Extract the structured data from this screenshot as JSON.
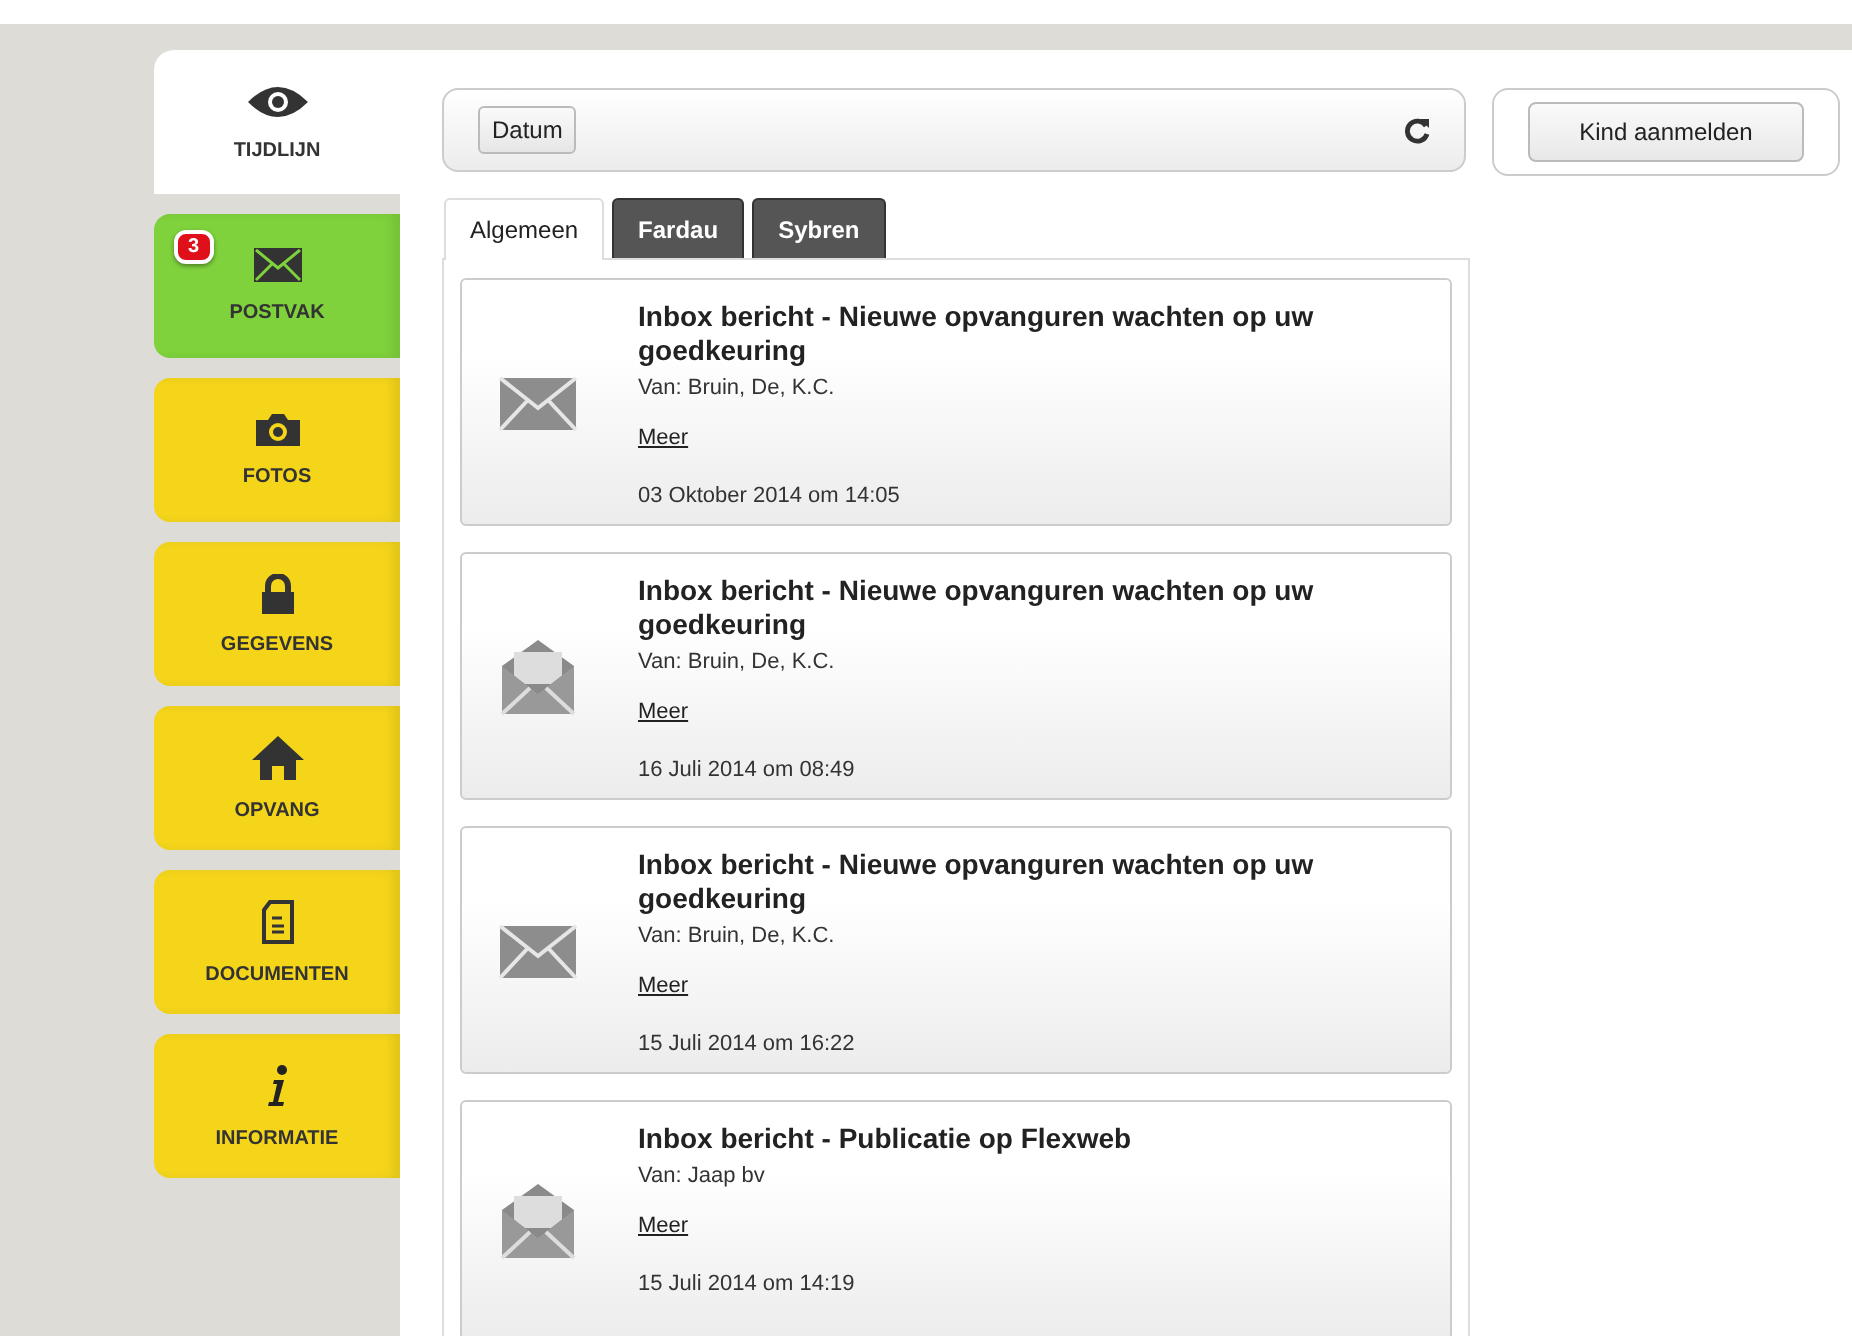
{
  "sidebar": {
    "items": [
      {
        "label": "TIJDLIJN",
        "kind": "eye",
        "selected": true,
        "color": "#ffffff"
      },
      {
        "label": "POSTVAK",
        "kind": "mail",
        "selected": false,
        "color": "#7fd23c",
        "badge": "3"
      },
      {
        "label": "FOTOS",
        "kind": "camera",
        "selected": false,
        "color": "#f5d51a"
      },
      {
        "label": "GEGEVENS",
        "kind": "lock",
        "selected": false,
        "color": "#f5d51a"
      },
      {
        "label": "OPVANG",
        "kind": "home",
        "selected": false,
        "color": "#f5d51a"
      },
      {
        "label": "DOCUMENTEN",
        "kind": "document",
        "selected": false,
        "color": "#f5d51a"
      },
      {
        "label": "INFORMATIE",
        "kind": "info",
        "selected": false,
        "color": "#f5d51a"
      }
    ]
  },
  "toolbar": {
    "sort_button": "Datum"
  },
  "register_button": "Kind aanmelden",
  "tabs": [
    {
      "label": "Algemeen",
      "selected": true
    },
    {
      "label": "Fardau",
      "selected": false
    },
    {
      "label": "Sybren",
      "selected": false
    }
  ],
  "messages": [
    {
      "title": "Inbox bericht - Nieuwe opvanguren wachten op uw goedkeuring",
      "sender": "Van: Bruin, De, K.C.",
      "link": "Meer",
      "date": "03 Oktober 2014 om 14:05",
      "opened": false
    },
    {
      "title": "Inbox bericht - Nieuwe opvanguren wachten op uw goedkeuring",
      "sender": "Van: Bruin, De, K.C.",
      "link": "Meer",
      "date": "16 Juli 2014 om 08:49",
      "opened": true
    },
    {
      "title": "Inbox bericht - Nieuwe opvanguren wachten op uw goedkeuring",
      "sender": "Van: Bruin, De, K.C.",
      "link": "Meer",
      "date": "15 Juli 2014 om 16:22",
      "opened": false
    },
    {
      "title": "Inbox bericht - Publicatie op Flexweb",
      "sender": "Van: Jaap bv",
      "link": "Meer",
      "date": "15 Juli 2014 om 14:19",
      "opened": true
    }
  ]
}
